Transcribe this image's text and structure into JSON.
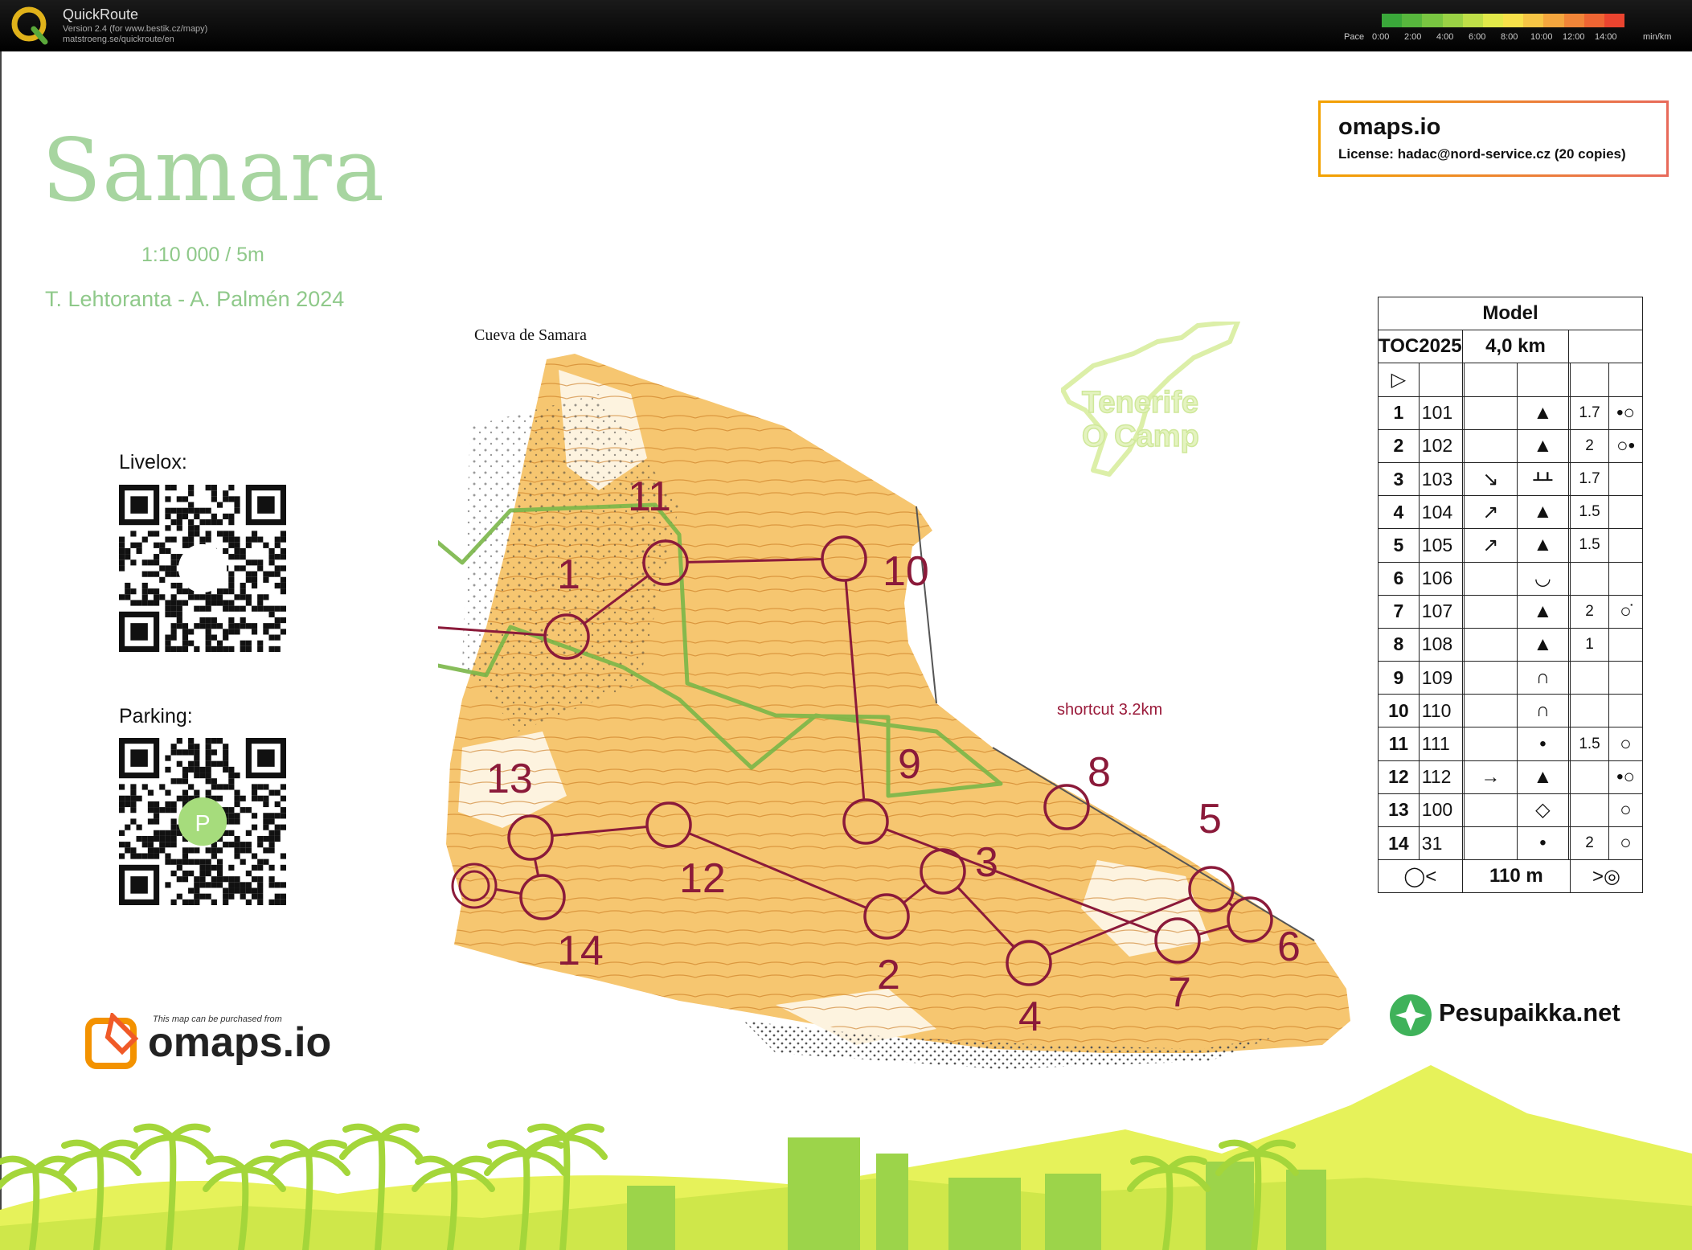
{
  "app": {
    "title": "QuickRoute",
    "version": "Version 2.4  (for www.bestik.cz/mapy)",
    "url": "matstroeng.se/quickroute/en",
    "pace_label": "Pace",
    "pace_ticks": [
      "0:00",
      "2:00",
      "4:00",
      "6:00",
      "8:00",
      "10:00",
      "12:00",
      "14:00"
    ],
    "pace_unit": "min/km",
    "pace_colors": [
      "#3aa83a",
      "#57b73d",
      "#79c641",
      "#9ad245",
      "#bfdf48",
      "#e2e94a",
      "#f7e14a",
      "#f6c545",
      "#f4a63e",
      "#f18538",
      "#ee6533",
      "#ea442f"
    ]
  },
  "map": {
    "title": "Samara",
    "scale": "1:10 000 / 5m",
    "authors": "T. Lehtoranta - A. Palmén 2024",
    "place_label": "Cueva de Samara",
    "shortcut_label": "shortcut 3.2km",
    "start_marker": "P"
  },
  "license": {
    "brand": "omaps.io",
    "text": "License: hadac@nord-service.cz (20 copies)"
  },
  "qr": {
    "livelox_label": "Livelox:",
    "parking_label": "Parking:",
    "parking_badge": "P"
  },
  "branding": {
    "omaps_tagline": "This map can be purchased from",
    "omaps_name": "omaps.io",
    "pesupaikka": "Pesupaikka.net",
    "tenerife_line1": "Tenerife",
    "tenerife_line2": "O Camp"
  },
  "controls": [
    "1",
    "2",
    "3",
    "4",
    "5",
    "6",
    "7",
    "8",
    "9",
    "10",
    "11",
    "12",
    "13",
    "14"
  ],
  "description": {
    "header": "Model",
    "event": "TOC2025",
    "length": "4,0 km",
    "start_symbol": "▷",
    "rows": [
      {
        "num": "1",
        "code": "101",
        "dir": "",
        "feature": "▲",
        "dim": "1.7",
        "loc": "•○"
      },
      {
        "num": "2",
        "code": "102",
        "dir": "",
        "feature": "▲",
        "dim": "2",
        "loc": "○•"
      },
      {
        "num": "3",
        "code": "103",
        "dir": "↘",
        "feature": "ᚆᚆ",
        "dim": "1.7",
        "loc": ""
      },
      {
        "num": "4",
        "code": "104",
        "dir": "↗",
        "feature": "▲",
        "dim": "1.5",
        "loc": ""
      },
      {
        "num": "5",
        "code": "105",
        "dir": "↗",
        "feature": "▲",
        "dim": "1.5",
        "loc": ""
      },
      {
        "num": "6",
        "code": "106",
        "dir": "",
        "feature": "◡",
        "dim": "",
        "loc": ""
      },
      {
        "num": "7",
        "code": "107",
        "dir": "",
        "feature": "▲",
        "dim": "2",
        "loc": "○̇"
      },
      {
        "num": "8",
        "code": "108",
        "dir": "",
        "feature": "▲",
        "dim": "1",
        "loc": ""
      },
      {
        "num": "9",
        "code": "109",
        "dir": "",
        "feature": "∩",
        "dim": "",
        "loc": ""
      },
      {
        "num": "10",
        "code": "110",
        "dir": "",
        "feature": "∩",
        "dim": "",
        "loc": ""
      },
      {
        "num": "11",
        "code": "111",
        "dir": "",
        "feature": "•",
        "dim": "1.5",
        "loc": "○"
      },
      {
        "num": "12",
        "code": "112",
        "dir": "→",
        "feature": "▲",
        "dim": "",
        "loc": "•○"
      },
      {
        "num": "13",
        "code": "100",
        "dir": "",
        "feature": "◇",
        "dim": "",
        "loc": "○"
      },
      {
        "num": "14",
        "code": "31",
        "dir": "",
        "feature": "•",
        "dim": "2",
        "loc": "○"
      }
    ],
    "finish_distance": "110 m"
  }
}
